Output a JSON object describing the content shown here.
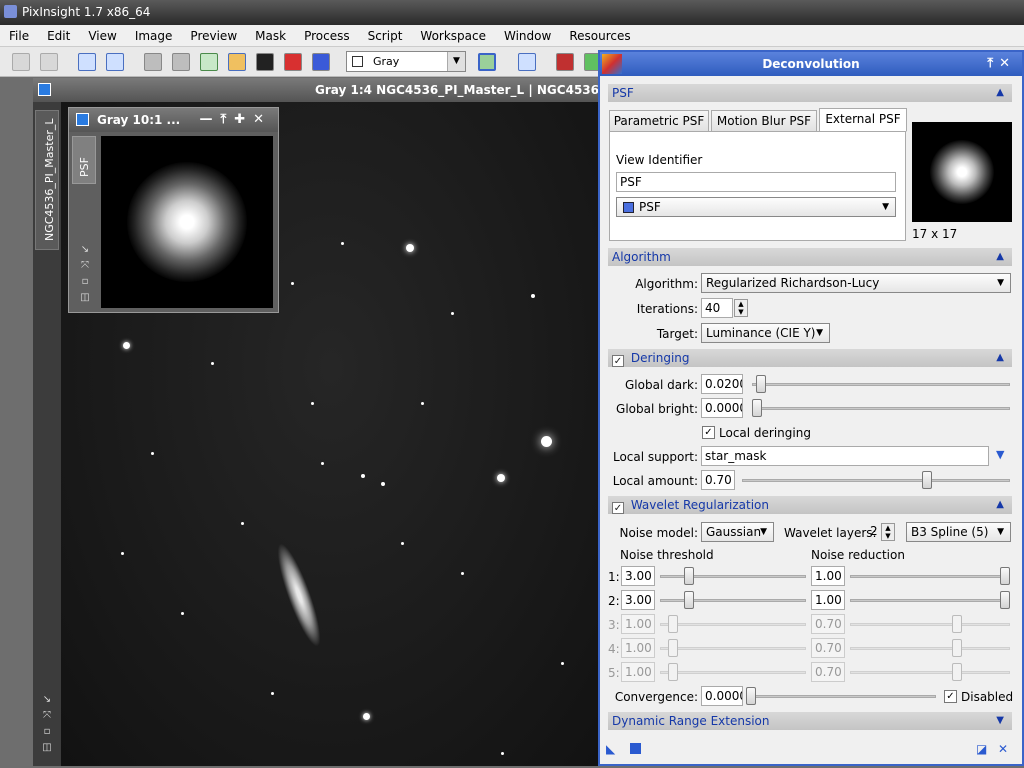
{
  "app": {
    "title": "PixInsight 1.7 x86_64"
  },
  "menu": [
    "File",
    "Edit",
    "View",
    "Image",
    "Preview",
    "Mask",
    "Process",
    "Script",
    "Workspace",
    "Window",
    "Resources"
  ],
  "toolbar": {
    "view_selector": "Gray"
  },
  "main_view": {
    "title": "Gray 1:4 NGC4536_PI_Master_L | NGC4536",
    "side_tab": "NGC4536_PI_Master_L"
  },
  "psf_window": {
    "title": "Gray 10:1 ...",
    "tab": "PSF"
  },
  "deconvolution": {
    "title": "Deconvolution",
    "psf_section": "PSF",
    "tabs": [
      "Parametric PSF",
      "Motion Blur PSF",
      "External PSF"
    ],
    "view_identifier_label": "View Identifier",
    "view_identifier_value": "PSF",
    "view_combo": "PSF",
    "psf_size": "17 x 17",
    "algorithm_section": "Algorithm",
    "algorithm_label": "Algorithm:",
    "algorithm_value": "Regularized Richardson-Lucy",
    "iterations_label": "Iterations:",
    "iterations_value": "40",
    "target_label": "Target:",
    "target_value": "Luminance (CIE Y)",
    "deringing_section": "Deringing",
    "global_dark_label": "Global dark:",
    "global_dark_value": "0.0200",
    "global_bright_label": "Global bright:",
    "global_bright_value": "0.0000",
    "local_deringing_label": "Local deringing",
    "local_support_label": "Local support:",
    "local_support_value": "star_mask",
    "local_amount_label": "Local amount:",
    "local_amount_value": "0.70",
    "wavelet_section": "Wavelet Regularization",
    "noise_model_label": "Noise model:",
    "noise_model_value": "Gaussian",
    "wavelet_layers_label": "Wavelet layers:",
    "wavelet_layers_value": "2",
    "scaling_value": "B3 Spline (5)",
    "noise_threshold_header": "Noise threshold",
    "noise_reduction_header": "Noise reduction",
    "layers": [
      {
        "n": "1:",
        "threshold": "3.00",
        "reduction": "1.00"
      },
      {
        "n": "2:",
        "threshold": "3.00",
        "reduction": "1.00"
      },
      {
        "n": "3:",
        "threshold": "1.00",
        "reduction": "0.70"
      },
      {
        "n": "4:",
        "threshold": "1.00",
        "reduction": "0.70"
      },
      {
        "n": "5:",
        "threshold": "1.00",
        "reduction": "0.70"
      }
    ],
    "convergence_label": "Convergence:",
    "convergence_value": "0.0000",
    "disabled_label": "Disabled",
    "dre_section": "Dynamic Range Extension"
  }
}
